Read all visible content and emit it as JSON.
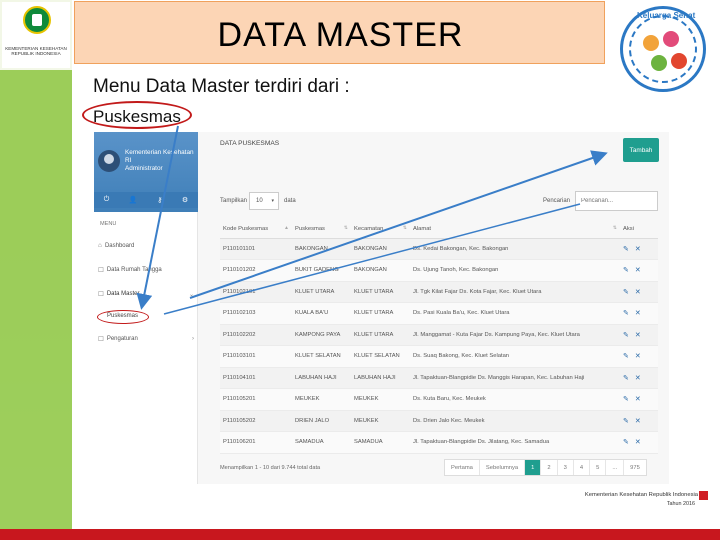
{
  "slide": {
    "title": "DATA MASTER",
    "subtitle": "Menu Data Master terdiri dari :",
    "item_label": "Puskesmas"
  },
  "logo_left": {
    "caption": "KEMENTERIAN KESEHATAN REPUBLIK INDONESIA"
  },
  "logo_right": {
    "text": "Keluarga Sehat"
  },
  "sidebar": {
    "profile_name": "Kementerian Kesehatan RI",
    "profile_role": "Administrator",
    "menu_header": "MENU",
    "items": [
      {
        "label": "Dashboard",
        "icon": "home-icon"
      },
      {
        "label": "Data Rumah Tangga",
        "icon": "folder-icon"
      },
      {
        "label": "Data Master",
        "icon": "folder-icon"
      },
      {
        "label": "Pengaturan",
        "icon": "folder-icon"
      }
    ],
    "sub_item": "Puskesmas"
  },
  "panel": {
    "title": "DATA PUSKESMAS",
    "add_button": "Tambah",
    "show_label": "Tampilkan",
    "show_value": "10",
    "show_after": "data",
    "search_label": "Pencarian",
    "search_placeholder": "Pencarian..."
  },
  "table": {
    "columns": [
      "Kode Puskesmas",
      "Puskesmas",
      "Kecamatan",
      "Alamat",
      "Aksi"
    ],
    "rows": [
      [
        "P110101101",
        "BAKONGAN",
        "BAKONGAN",
        "Ds. Kedai Bakongan, Kec. Bakongan"
      ],
      [
        "P110101202",
        "BUKIT GADENG",
        "BAKONGAN",
        "Ds. Ujung Tanoh, Kec. Bakongan"
      ],
      [
        "P110102101",
        "KLUET UTARA",
        "KLUET UTARA",
        "Jl. Tgk Kilat Fajar Ds. Kota Fajar, Kec. Kluet Utara"
      ],
      [
        "P110102103",
        "KUALA BA'U",
        "KLUET UTARA",
        "Ds. Pasi Kuala Ba'u, Kec. Kluet Utara"
      ],
      [
        "P110102202",
        "KAMPONG PAYA",
        "KLUET UTARA",
        "Jl. Manggamat - Kuta Fajar Ds. Kampung Paya, Kec. Kluet Utara"
      ],
      [
        "P110103101",
        "KLUET SELATAN",
        "KLUET SELATAN",
        "Ds. Suaq Bakong, Kec. Kluet Selatan"
      ],
      [
        "P110104101",
        "LABUHAN HAJI",
        "LABUHAN HAJI",
        "Jl. Tapaktuan-Blangpidie Ds. Manggis Harapan, Kec. Labuhan Haji"
      ],
      [
        "P110105201",
        "MEUKEK",
        "MEUKEK",
        "Ds. Kuta Baru, Kec. Meukek"
      ],
      [
        "P110105202",
        "DRIEN JALO",
        "MEUKEK",
        "Ds. Drien Jalo Kec. Meukek"
      ],
      [
        "P110106201",
        "SAMADUA",
        "SAMADUA",
        "Jl. Tapaktuan-Blangpidie Ds. Jilatang, Kec. Samadua"
      ]
    ]
  },
  "footer_info": "Menampilkan 1 - 10 dari 9.744 total data",
  "pagination": [
    "Pertama",
    "Sebelumnya",
    "1",
    "2",
    "3",
    "4",
    "5",
    "...",
    "975"
  ],
  "footer": {
    "ministry": "Kementerian Kesehatan Republik Indonesia",
    "year": "Tahun 2016"
  },
  "colors": {
    "accent": "#1f9e8f",
    "annotation_red": "#c21a1a",
    "arrow_blue": "#3a7ec8",
    "title_bg": "#fcd5b5",
    "left_green": "#8cc63f",
    "bottom_bar": "#c8171e"
  }
}
